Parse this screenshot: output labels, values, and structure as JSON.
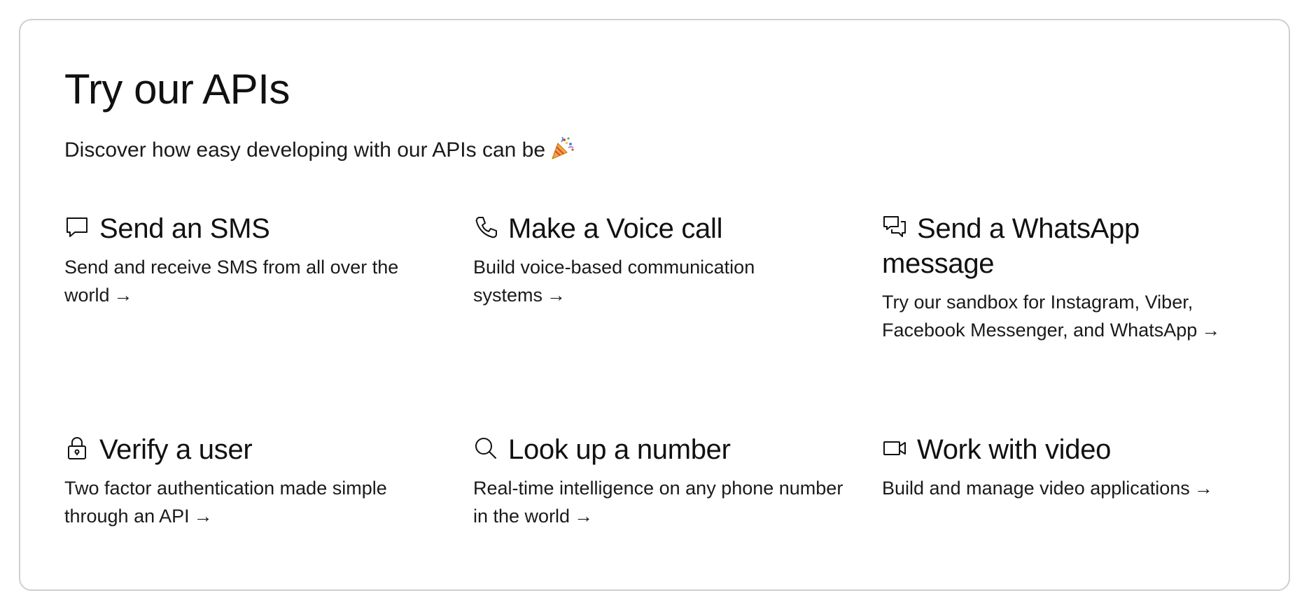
{
  "header": {
    "title": "Try our APIs",
    "subtitle": "Discover how easy developing with our APIs can be",
    "subtitle_emoji_icon": "party-popper-icon"
  },
  "features": [
    {
      "icon": "chat-bubble-icon",
      "title": "Send an SMS",
      "description": "Send and receive SMS from all over the world",
      "arrow": "→"
    },
    {
      "icon": "phone-icon",
      "title": "Make a Voice call",
      "description": "Build voice-based communication systems",
      "arrow": "→"
    },
    {
      "icon": "chat-bubbles-icon",
      "title": "Send a WhatsApp message",
      "description": "Try our sandbox for Instagram, Viber, Facebook Messenger, and WhatsApp",
      "arrow": "→"
    },
    {
      "icon": "lock-icon",
      "title": "Verify a user",
      "description": "Two factor authentication made simple through an API",
      "arrow": "→"
    },
    {
      "icon": "search-icon",
      "title": "Look up a number",
      "description": "Real-time intelligence on any phone number in the world",
      "arrow": "→"
    },
    {
      "icon": "video-camera-icon",
      "title": "Work with video",
      "description": "Build and manage video applications",
      "arrow": "→"
    }
  ],
  "colors": {
    "text": "#111111",
    "border": "#cfcfcf",
    "background": "#ffffff"
  }
}
